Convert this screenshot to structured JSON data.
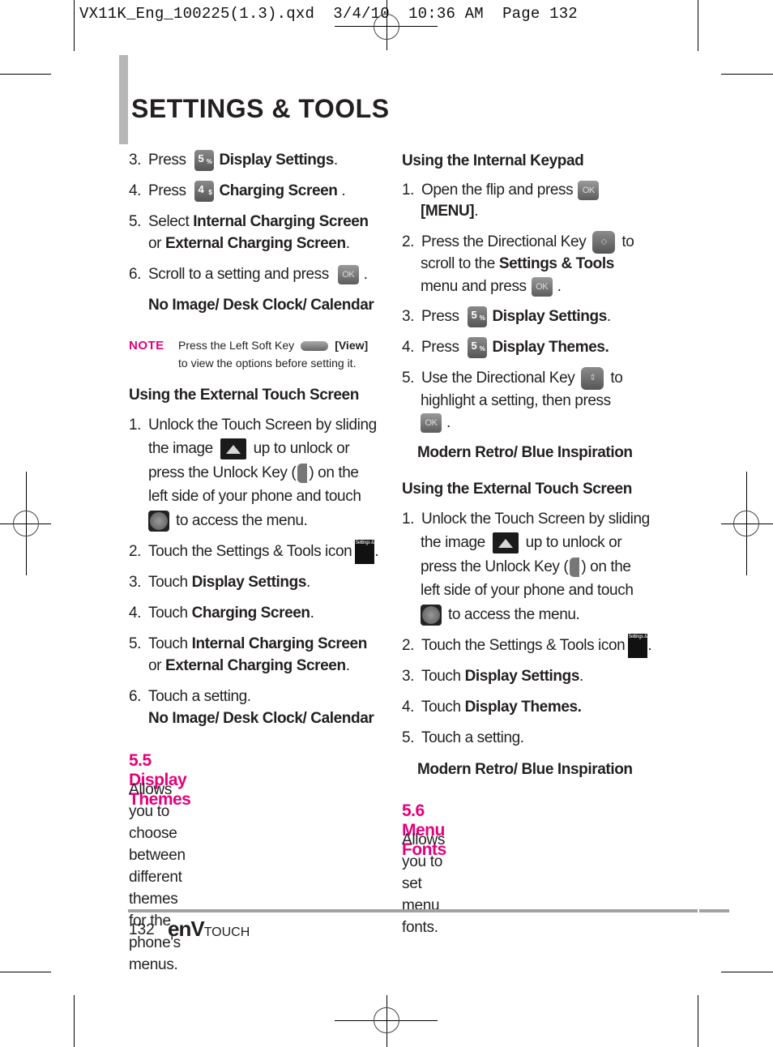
{
  "slug": "VX11K_Eng_100225(1.3).qxd  3/4/10  10:36 AM  Page 132",
  "page_title": "SETTINGS & TOOLS",
  "left": {
    "steps_a": [
      {
        "num": "3.",
        "pre": "Press",
        "key": "5",
        "sup": "%",
        "bold": "Display Settings",
        "post": "."
      },
      {
        "num": "4.",
        "pre": "Press",
        "key": "4",
        "sup": "$",
        "bold": "Charging Screen",
        "post": " ."
      },
      {
        "num": "5.",
        "pre": "Select ",
        "bold": "Internal Charging Screen",
        "line2_pre": "or ",
        "line2_bold": "External Charging Screen",
        "line2_post": "."
      },
      {
        "num": "6.",
        "pre": "Scroll to a setting and press",
        "ok": "OK",
        "post": "."
      }
    ],
    "options_a": "No Image/ Desk Clock/ Calendar",
    "note": {
      "label": "NOTE",
      "line1_pre": "Press the Left Soft Key",
      "line1_bold": "[View]",
      "line2": "to view the options before setting it."
    },
    "ext_heading": "Using the External Touch Screen",
    "ext_steps": {
      "s1": {
        "num": "1.",
        "l1": "Unlock the Touch Screen by sliding",
        "l2_pre": "the image",
        "l2_post": "up to unlock or",
        "l3_pre": "press the Unlock Key (",
        "l3_post": ") on the",
        "l4": "left side of your phone and touch",
        "l5": "to access the menu."
      },
      "s2": {
        "num": "2.",
        "text": "Touch the Settings & Tools icon",
        "post": ".",
        "icon_text": "Settings & Tools"
      },
      "s3": {
        "num": "3.",
        "pre": "Touch ",
        "bold": "Display Settings",
        "post": "."
      },
      "s4": {
        "num": "4.",
        "pre": "Touch ",
        "bold": "Charging Screen",
        "post": "."
      },
      "s5": {
        "num": "5.",
        "pre": "Touch ",
        "bold": "Internal Charging Screen",
        "line2_pre": "or ",
        "line2_bold": "External Charging Screen",
        "line2_post": "."
      },
      "s6": {
        "num": "6.",
        "text": "Touch a setting."
      }
    },
    "options_b": "No Image/ Desk Clock/ Calendar",
    "section_55": {
      "title": "5.5 Display Themes",
      "body_lines": [
        "Allows you to choose between",
        "different themes for the phone's",
        "menus."
      ]
    }
  },
  "right": {
    "int_heading": "Using the Internal Keypad",
    "steps": {
      "s1": {
        "num": "1.",
        "pre": "Open the flip and press",
        "ok": "OK",
        "line2_bold": "[MENU]",
        "line2_post": "."
      },
      "s2": {
        "num": "2.",
        "pre": "Press the Directional Key",
        "post": "to",
        "line2_pre": "scroll to the ",
        "line2_bold": "Settings & Tools",
        "line3_pre": "menu and press",
        "ok": "OK",
        "line3_post": "."
      },
      "s3": {
        "num": "3.",
        "pre": "Press",
        "key": "5",
        "sup": "%",
        "bold": "Display Settings",
        "post": "."
      },
      "s4": {
        "num": "4.",
        "pre": "Press",
        "key": "5",
        "sup": "%",
        "bold": "Display Themes."
      },
      "s5": {
        "num": "5.",
        "pre": "Use the Directional Key",
        "post": "to",
        "line2": "highlight a setting, then press",
        "ok": "OK",
        "line3_post": "."
      }
    },
    "options_a": "Modern Retro/ Blue Inspiration",
    "ext_heading": "Using the External Touch Screen",
    "ext_steps": {
      "s1": {
        "num": "1.",
        "l1": "Unlock the Touch Screen by sliding",
        "l2_pre": "the image",
        "l2_post": "up to unlock or",
        "l3_pre": "press the Unlock Key (",
        "l3_post": ") on the",
        "l4": "left side of your phone and touch",
        "l5": "to access the menu."
      },
      "s2": {
        "num": "2.",
        "text": "Touch the Settings & Tools icon",
        "post": ".",
        "icon_text": "Settings & Tools"
      },
      "s3": {
        "num": "3.",
        "pre": "Touch ",
        "bold": "Display Settings",
        "post": "."
      },
      "s4": {
        "num": "4.",
        "pre": "Touch ",
        "bold": "Display Themes."
      },
      "s5": {
        "num": "5.",
        "text": "Touch a setting."
      }
    },
    "options_b": "Modern Retro/ Blue Inspiration",
    "section_56": {
      "title": "5.6 Menu Fonts",
      "body": "Allows you to set menu fonts."
    }
  },
  "footer": {
    "page_number": "132",
    "brand_main": "enV",
    "brand_sub": "TOUCH"
  },
  "colors": {
    "accent": "#e4007c",
    "text": "#231f20",
    "rule": "#a2a2a2",
    "title_bar": "#b7b7b7"
  }
}
